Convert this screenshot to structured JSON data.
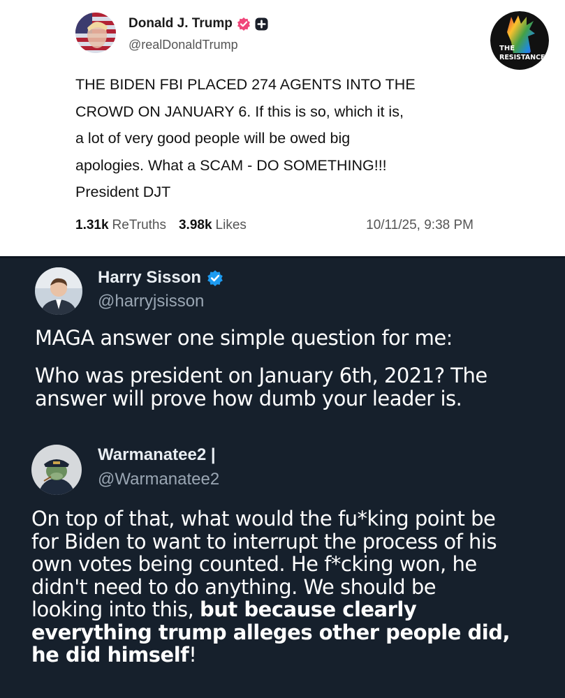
{
  "truth_post": {
    "author_name": "Donald J. Trump",
    "author_handle": "@realDonaldTrump",
    "body_lines": [
      "THE BIDEN FBI PLACED 274 AGENTS INTO THE",
      "CROWD ON JANUARY 6. If this is so, which it is,",
      "a lot of very good people will be owed big",
      "apologies. What a SCAM - DO SOMETHING!!!",
      "President DJT"
    ],
    "retruths_count": "1.31k",
    "retruths_label": "ReTruths",
    "likes_count": "3.98k",
    "likes_label": "Likes",
    "date": "10/11/25, 9:38 PM",
    "badge_lines": [
      "THE",
      "RESISTANCE"
    ]
  },
  "reply_1": {
    "author_name": "Harry Sisson",
    "author_handle": "@harryjsisson",
    "paragraph_1": "MAGA answer one simple question for me:",
    "paragraph_2_lines": [
      "Who was president on January 6th, 2021? The",
      "answer will prove how dumb your leader is."
    ]
  },
  "reply_2": {
    "author_name": "Warmanatee2 |",
    "author_handle": "@Warmanatee2",
    "body_lines": [
      "On top of that, what would the fu*king point be",
      "for Biden to want to interrupt the process of his",
      "own votes being counted. He f*cking won, he",
      "didn't need to do anything. We should be"
    ],
    "line_5_regular": "looking into this, ",
    "line_5_bold": "but because clearly",
    "bold_line_6": "everything trump alleges other people did,",
    "bold_line_7": "he did himself",
    "tail": "!"
  },
  "colors": {
    "verified_orange": "#f0467a",
    "verified_blue": "#1d9bf0",
    "dark_bg": "#16202c"
  }
}
